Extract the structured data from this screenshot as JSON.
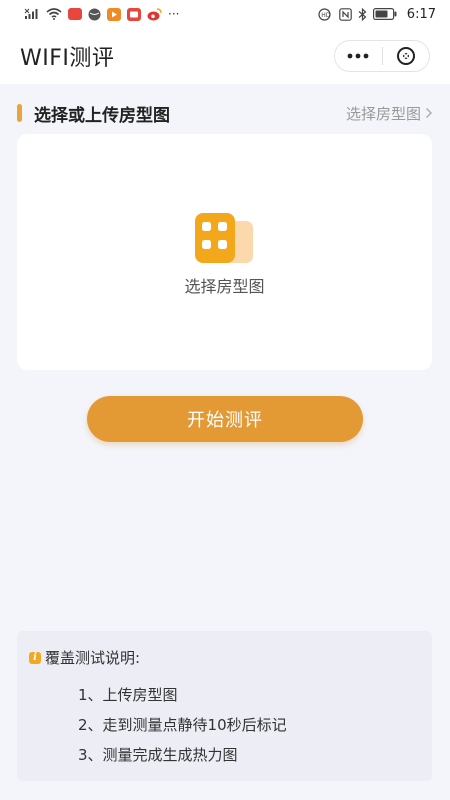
{
  "status_bar": {
    "time": "6:17",
    "more": "···",
    "network_icons": [
      "signal-icon",
      "wifi-icon"
    ],
    "app_icons": [
      {
        "name": "message-app-icon",
        "color": "#e8453c"
      },
      {
        "name": "globe-app-icon",
        "color": "#555555"
      },
      {
        "name": "video-app-icon",
        "color": "#f08a24"
      },
      {
        "name": "tv-app-icon",
        "color": "#e8453c"
      },
      {
        "name": "weibo-app-icon",
        "color": "#e2352f"
      }
    ],
    "right_icons": [
      "hd-icon",
      "nfc-icon",
      "bluetooth-icon",
      "battery-icon"
    ]
  },
  "nav": {
    "title": "WIFI测评"
  },
  "section": {
    "title": "选择或上传房型图",
    "link": "选择房型图"
  },
  "upload_card": {
    "label": "选择房型图"
  },
  "start_button": {
    "label": "开始测评"
  },
  "info": {
    "badge": "i",
    "title": "覆盖测试说明:",
    "steps": [
      "1、上传房型图",
      "2、走到测量点静待10秒后标记",
      "3、测量完成生成热力图"
    ]
  },
  "colors": {
    "accent": "#e39a35",
    "accent_bar": "#e8a53b",
    "background": "#f4f5fa",
    "info_background": "#ecedf5"
  }
}
